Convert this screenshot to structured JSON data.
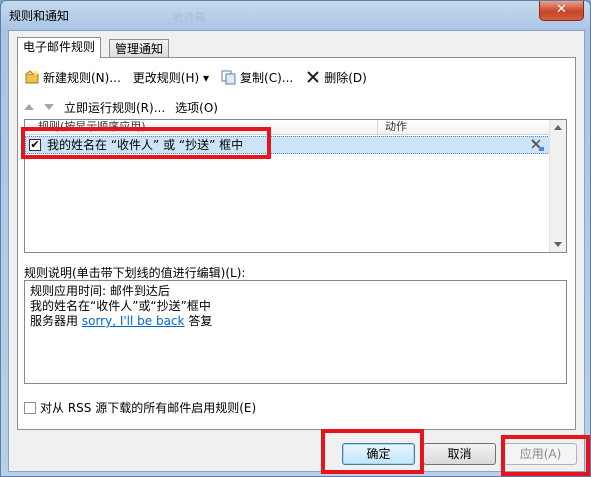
{
  "window": {
    "title": "规则和通知",
    "ghost_title": "收件箱"
  },
  "tabs": [
    {
      "label": "电子邮件规则",
      "active": true
    },
    {
      "label": "管理通知",
      "active": false
    }
  ],
  "toolbar": {
    "new_rule": "新建规则(N)...",
    "change_rule": "更改规则(H) ▾",
    "copy": "复制(C)...",
    "delete": "删除(D)"
  },
  "toolbar2": {
    "run_now": "立即运行规则(R)...",
    "options": "选项(O)"
  },
  "rules_list": {
    "col_rule": "规则(按显示顺序应用)",
    "col_action": "动作",
    "rows": [
      {
        "checked": true,
        "checkmark": "✔",
        "name": "我的姓名在 “收件人” 或 “抄送” 框中"
      }
    ]
  },
  "description": {
    "label": "规则说明(单击带下划线的值进行编辑)(L):",
    "line1": "规则应用时间: 邮件到达后",
    "line2": "我的姓名在“收件人”或“抄送”框中",
    "line3_prefix": "服务器用",
    "line3_link": "sorry, I'll be back",
    "line3_suffix": "答复"
  },
  "rss": {
    "label": "对从 RSS 源下载的所有邮件启用规则(E)"
  },
  "buttons": {
    "ok": "确定",
    "cancel": "取消",
    "apply": "应用(A)"
  },
  "close_glyph": "✕",
  "colors": {
    "selection": "#cce4f7",
    "link": "#0066cc",
    "highlight": "#e8141c"
  }
}
